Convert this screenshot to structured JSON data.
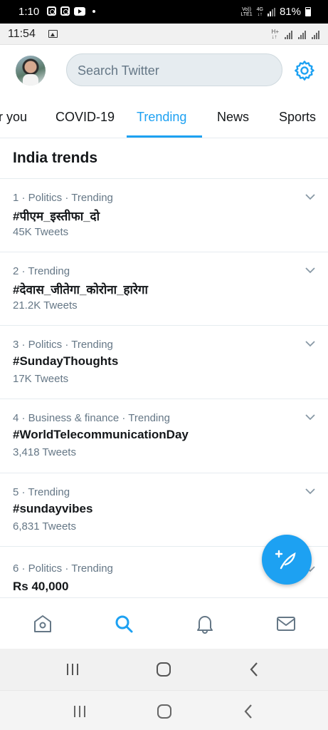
{
  "outer_status": {
    "time": "1:10",
    "battery": "81%",
    "net_top": "Vo))",
    "net_bottom": "LTE1",
    "net_gen": "4G"
  },
  "inner_status": {
    "time": "11:54",
    "net_label": "H+"
  },
  "header": {
    "search_placeholder": "Search Twitter"
  },
  "tabs": [
    {
      "label": "r you",
      "active": false
    },
    {
      "label": "COVID-19",
      "active": false
    },
    {
      "label": "Trending",
      "active": true
    },
    {
      "label": "News",
      "active": false
    },
    {
      "label": "Sports",
      "active": false
    }
  ],
  "section_title": "India trends",
  "trends": [
    {
      "meta": "1 · Politics · Trending",
      "name": "#पीएम_इस्तीफा_दो",
      "count": "45K Tweets"
    },
    {
      "meta": "2 · Trending",
      "name": "#देवास_जीतेगा_कोरोना_हारेगा",
      "count": "21.2K Tweets"
    },
    {
      "meta": "3 · Politics · Trending",
      "name": "#SundayThoughts",
      "count": "17K Tweets"
    },
    {
      "meta": "4 · Business & finance · Trending",
      "name": "#WorldTelecommunicationDay",
      "count": "3,418 Tweets"
    },
    {
      "meta": "5 · Trending",
      "name": "#sundayvibes",
      "count": "6,831 Tweets"
    },
    {
      "meta": "6 · Politics · Trending",
      "name": "Rs 40,000",
      "count": ""
    }
  ],
  "icons": {
    "gear": "gear-icon",
    "compose": "compose-tweet-icon",
    "home": "home-icon",
    "search": "search-icon",
    "notifications": "bell-icon",
    "messages": "mail-icon"
  },
  "colors": {
    "accent": "#1da1f2",
    "text_primary": "#14171a",
    "text_secondary": "#657786",
    "divider": "#e6ecf0"
  }
}
